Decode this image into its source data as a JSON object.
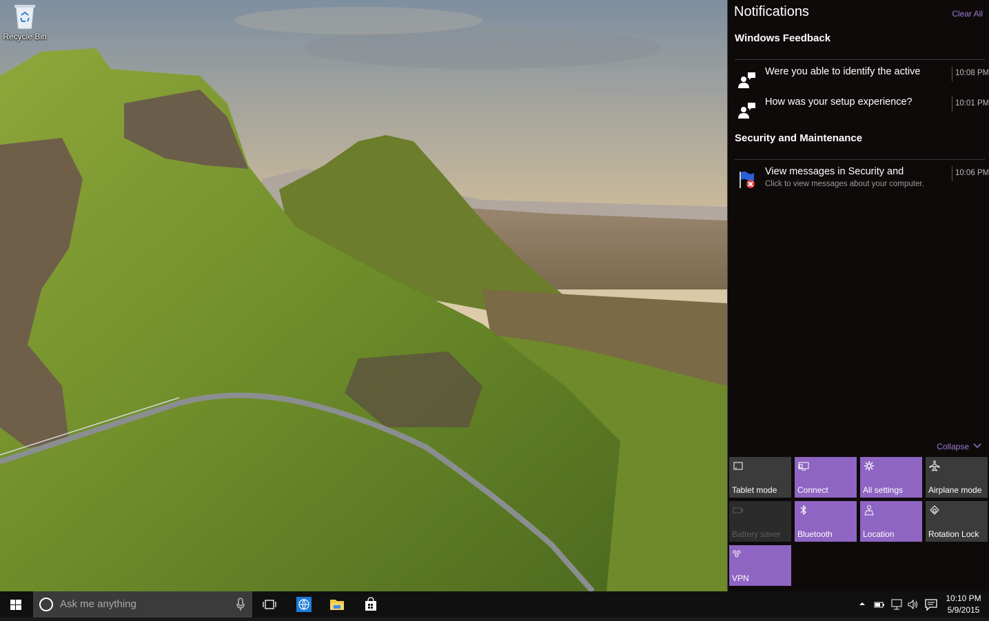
{
  "desktop": {
    "icons": [
      {
        "label": "Recycle Bin",
        "icon": "recycle-bin-icon"
      }
    ]
  },
  "action_center": {
    "title": "Notifications",
    "clear_all": "Clear All",
    "collapse": "Collapse",
    "groups": [
      {
        "title": "Windows Feedback",
        "notifications": [
          {
            "text": "Were you able to identify the active",
            "time": "10:08 PM",
            "icon": "feedback-person-icon"
          },
          {
            "text": "How was your setup experience?",
            "time": "10:01 PM",
            "icon": "feedback-person-icon"
          }
        ]
      },
      {
        "title": "Security and Maintenance",
        "notifications": [
          {
            "text": "View messages in Security and",
            "subtext": "Click to view messages about your computer.",
            "time": "10:06 PM",
            "icon": "security-flag-icon"
          }
        ]
      }
    ],
    "quick_actions": [
      {
        "label": "Tablet mode",
        "state": "off",
        "icon": "tablet-mode-icon"
      },
      {
        "label": "Connect",
        "state": "on",
        "icon": "connect-icon"
      },
      {
        "label": "All settings",
        "state": "on",
        "icon": "settings-gear-icon"
      },
      {
        "label": "Airplane mode",
        "state": "off",
        "icon": "airplane-icon"
      },
      {
        "label": "Battery saver",
        "state": "disabled",
        "icon": "battery-saver-icon"
      },
      {
        "label": "Bluetooth",
        "state": "on",
        "icon": "bluetooth-icon"
      },
      {
        "label": "Location",
        "state": "on",
        "icon": "location-icon"
      },
      {
        "label": "Rotation Lock",
        "state": "off",
        "icon": "rotation-lock-icon"
      },
      {
        "label": "VPN",
        "state": "on",
        "icon": "vpn-icon"
      }
    ],
    "accent_color": "#8e65c2",
    "link_color": "#9a7cd8"
  },
  "taskbar": {
    "search_placeholder": "Ask me anything",
    "pinned": [
      "task-view-icon",
      "edge-browser-icon",
      "file-explorer-icon",
      "store-icon"
    ],
    "tray_icons": [
      "show-hidden-icons-chevron-icon",
      "power-battery-icon",
      "network-icon",
      "volume-icon",
      "action-center-icon"
    ],
    "time": "10:10 PM",
    "date": "5/9/2015"
  }
}
